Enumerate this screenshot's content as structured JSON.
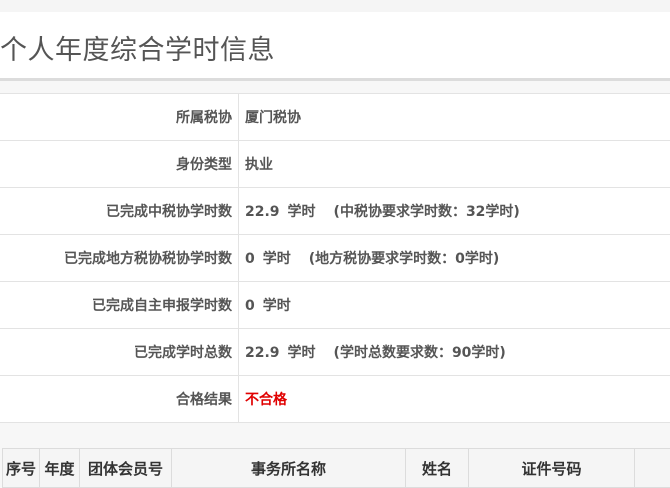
{
  "page": {
    "title": "个人年度综合学时信息"
  },
  "info": [
    {
      "label": "所属税协",
      "value": "厦门税协"
    },
    {
      "label": "身份类型",
      "value": "执业"
    },
    {
      "label": "已完成中税协学时数",
      "value": "22.9",
      "unit": "学时",
      "note": "(中税协要求学时数：32学时)"
    },
    {
      "label": "已完成地方税协税协学时数",
      "value": "0",
      "unit": "学时",
      "note": "(地方税协要求学时数：0学时)"
    },
    {
      "label": "已完成自主申报学时数",
      "value": "0",
      "unit": "学时"
    },
    {
      "label": "已完成学时总数",
      "value": "22.9",
      "unit": "学时",
      "note": "(学时总数要求数：90学时)"
    },
    {
      "label": "合格结果",
      "value": "不合格"
    }
  ],
  "colors": {
    "fail": "#e00000"
  },
  "records": {
    "columns": [
      "序号",
      "年度",
      "团体会员号",
      "事务所名称",
      "姓名",
      "证件号码",
      ""
    ]
  }
}
